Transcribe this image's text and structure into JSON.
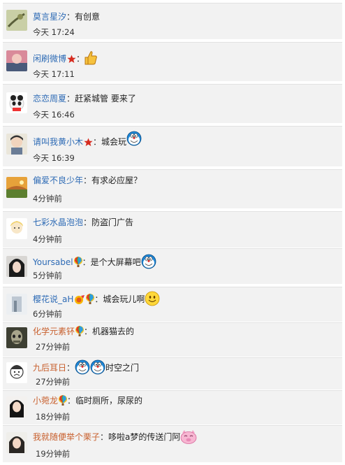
{
  "comments": [
    {
      "name": "莫言星汐",
      "text": "有创意",
      "time": "今天 17:24"
    },
    {
      "name": "闲刷微博",
      "text": "",
      "time": "今天 17:11",
      "badge": "star-icon",
      "emoji": "thumbs-up-icon"
    },
    {
      "name": "恋恋周夏",
      "text": "赶紧城管 要来了",
      "time": "今天 16:46"
    },
    {
      "name": "请叫我黄小木",
      "text": "城会玩",
      "time": "今天 16:39",
      "badge": "star-icon",
      "emoji": "doraemon-icon"
    },
    {
      "name": "偏爱不良少年",
      "text": "有求必应屋？",
      "time": "4分钟前"
    },
    {
      "name": "七彩水晶泡泡",
      "text": "防盗门广告",
      "time": "4分钟前"
    },
    {
      "name": "Yoursabel",
      "text": "是个大屏幕吧",
      "time": "5分钟前",
      "badge": "balloon-icon",
      "emoji": "doraemon-icon"
    },
    {
      "name": "樱花说_aH",
      "text": "城会玩儿啊",
      "time": "6分钟前",
      "badge": "balloon-icon",
      "emoji": "smile-icon"
    },
    {
      "name": "化学元素钚",
      "text": "机器猫去的",
      "time": "27分钟前",
      "badge": "balloon-icon"
    },
    {
      "name": "九后耳日",
      "text": "时空之门",
      "time": "27分钟前",
      "emoji": "doraemon-pair-icon"
    },
    {
      "name": "小菀龙",
      "text": "临时厕所，尿尿的",
      "time": "18分钟前",
      "badge": "balloon-icon"
    },
    {
      "name": "我就随便举个栗子",
      "text": "哆啦a梦的传送门阿",
      "time": "19分钟前",
      "emoji": "pig-face-icon"
    }
  ],
  "colors": {
    "name_blue": "#2e6bb5",
    "name_orange": "#c8602e",
    "row_bg": "#f2f2f2"
  }
}
